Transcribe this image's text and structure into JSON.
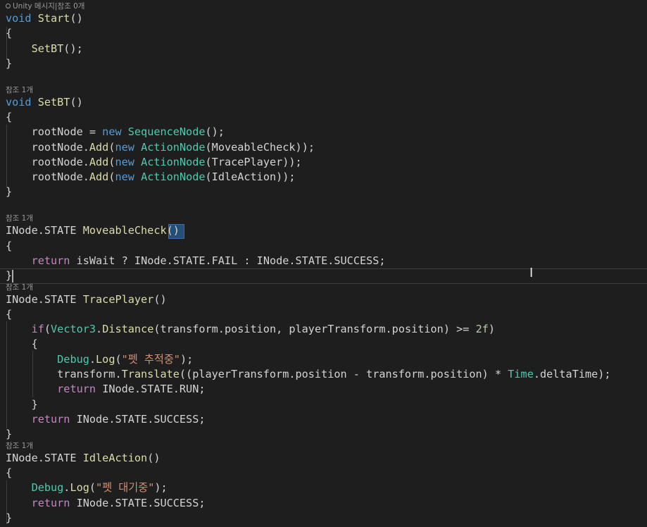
{
  "codelens": {
    "start": "Unity 메시지|참조 0개",
    "setbt": "참조 1개",
    "moveable": "참조 1개",
    "trace": "참조 1개",
    "idle": "참조 1개"
  },
  "code": {
    "void": "void",
    "start_name": "Start",
    "parens": "()",
    "open_brace": "{",
    "close_brace": "}",
    "setbt_call": "SetBT",
    "call_end": "();",
    "setbt_name": "SetBT",
    "rootNode": "rootNode",
    "eq": " = ",
    "new": "new",
    "SequenceNode": "SequenceNode",
    "dot": ".",
    "add": "Add",
    "open_paren": "(",
    "ActionNode": "ActionNode",
    "MoveableCheck": "MoveableCheck",
    "TracePlayer": "TracePlayer",
    "IdleAction": "IdleAction",
    "close_add": "));",
    "inode_state": "INode.STATE",
    "return": "return",
    "isWait": "isWait",
    "ternary_q": " ? ",
    "ternary_c": " : ",
    "state_fail": "INode.STATE.FAIL",
    "state_success": "INode.STATE.SUCCESS;",
    "if": "if",
    "Vector3": "Vector3",
    "Distance": "Distance",
    "dist_args": "(transform.position, playerTransform.position) ",
    "ge": ">=",
    "num_2f": "2f",
    "close_if": ")",
    "Debug": "Debug",
    "Log": "Log",
    "str_trace": "\"펫 추적중\"",
    "str_idle": "\"펫 대기중\"",
    "close_log": ");",
    "transform": "transform",
    "Translate": "Translate",
    "translate_args": "((playerTransform.position - transform.position) ",
    "mul": "*",
    "Time": "Time",
    "deltaTime": ".deltaTime);",
    "state_run": "INode.STATE.RUN;"
  }
}
